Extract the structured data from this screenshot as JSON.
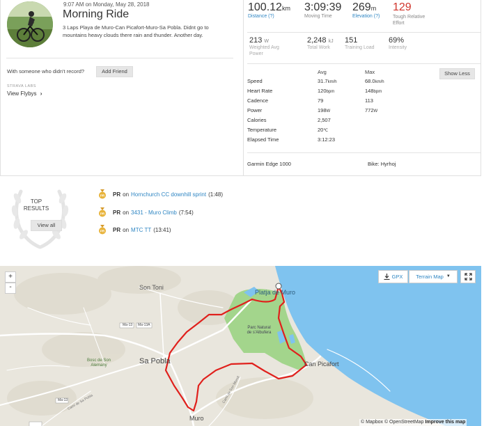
{
  "activity": {
    "date": "9:07 AM on Monday, May 28, 2018",
    "title": "Morning Ride",
    "description": "3 Laps Playa de Muro-Can Picafort-Muro-Sa Pobla. Didnt go to mountains heavy clouds there rain and thunder. Another day."
  },
  "social": {
    "with_text": "With someone who didn't record?",
    "add_friend": "Add Friend",
    "labs_label": "STRAVA LABS",
    "flybys": "View Flybys",
    "flybys_chevron": "›"
  },
  "summary": {
    "distance": {
      "value": "100.12",
      "unit": "km",
      "label": "Distance (?)"
    },
    "moving_time": {
      "value": "3:09:39",
      "label": "Moving Time"
    },
    "elevation": {
      "value": "269",
      "unit": "m",
      "label": "Elevation (?)"
    },
    "tough": {
      "value": "129",
      "label_1": "Tough Relative",
      "label_2": "Effort"
    }
  },
  "secondary": {
    "power": {
      "value": "213",
      "unit": "W",
      "label_1": "Weighted Avg",
      "label_2": "Power"
    },
    "work": {
      "value": "2,248",
      "unit": "kJ",
      "label": "Total Work"
    },
    "load": {
      "value": "151",
      "label": "Training Load"
    },
    "intensity": {
      "value": "69%",
      "label": "Intensity"
    }
  },
  "stats_table": {
    "col_avg": "Avg",
    "col_max": "Max",
    "show_less": "Show Less",
    "rows": [
      {
        "label": "Speed",
        "avg": "31.7",
        "avg_unit": "km/h",
        "max": "68.0",
        "max_unit": "km/h"
      },
      {
        "label": "Heart Rate",
        "avg": "120",
        "avg_unit": "bpm",
        "max": "148",
        "max_unit": "bpm"
      },
      {
        "label": "Cadence",
        "avg": "79",
        "avg_unit": "",
        "max": "113",
        "max_unit": ""
      },
      {
        "label": "Power",
        "avg": "198",
        "avg_unit": "W",
        "max": "772",
        "max_unit": "W"
      },
      {
        "label": "Calories",
        "avg": "2,507",
        "avg_unit": "",
        "max": "",
        "max_unit": ""
      },
      {
        "label": "Temperature",
        "avg": "20",
        "avg_unit": "℃",
        "max": "",
        "max_unit": ""
      },
      {
        "label": "Elapsed Time",
        "avg": "3:12:23",
        "avg_unit": "",
        "max": "",
        "max_unit": ""
      }
    ],
    "device": "Garmin Edge 1000",
    "bike": "Bike: Hyrhoj"
  },
  "top_results": {
    "label_1": "TOP",
    "label_2": "RESULTS",
    "view_all": "View all",
    "items": [
      {
        "badge": "PR",
        "on": "on",
        "segment": "Hornchurch CC downhill sprint",
        "time": "(1:48)"
      },
      {
        "badge": "PR",
        "on": "on",
        "segment": "3431 - Muro Climb",
        "time": "(7:54)"
      },
      {
        "badge": "PR",
        "on": "on",
        "segment": "MTC TT",
        "time": "(13:41)"
      }
    ]
  },
  "map": {
    "zoom_in": "+",
    "zoom_out": "-",
    "gpx": "GPX",
    "terrain": "Terrain Map",
    "labels": {
      "son_toni": "Son Toni",
      "platja": "Platja de Muro",
      "parc": "Parc Natural",
      "albufera": "de s'Albufera",
      "sa_pobla": "Sa Pobla",
      "can_picafort": "Can Picafort",
      "bosc": "Bosc de Son",
      "alemany": "Alemany",
      "muro": "Muro",
      "road_1": "Ma-13A",
      "road_2": "Ma-13",
      "road_3": "Ma-13",
      "street_1": "Camí de Son Morell",
      "street_2": "Camí de Sa Pobla"
    },
    "attribution": "© Mapbox © OpenStreetMap",
    "improve": "Improve this map",
    "colors": {
      "route": "#e0201c",
      "water": "#7cc2ee",
      "park": "#9fd38a",
      "land": "#e9e6dd"
    }
  },
  "colors": {
    "link": "#2f86c3",
    "tough": "#d0352c",
    "medal": "#e8b33a"
  }
}
